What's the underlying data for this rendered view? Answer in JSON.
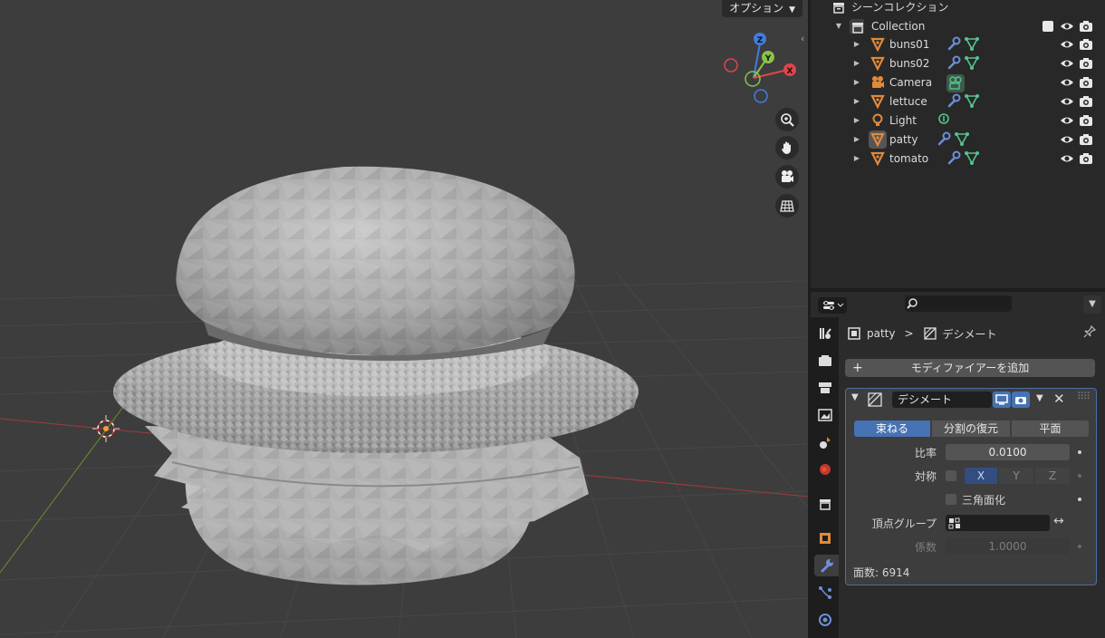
{
  "viewport": {
    "options_label": "オプション",
    "gizmo": {
      "x": "X",
      "y": "Y",
      "z": "Z"
    },
    "nav_icons": [
      "zoom-icon",
      "hand-pan-icon",
      "camera-view-icon",
      "grid-perspective-icon"
    ]
  },
  "outliner": {
    "scene_collection_label": "シーンコレクション",
    "collection_label": "Collection",
    "objects": [
      {
        "name": "buns01",
        "type": "mesh"
      },
      {
        "name": "buns02",
        "type": "mesh"
      },
      {
        "name": "Camera",
        "type": "camera"
      },
      {
        "name": "lettuce",
        "type": "mesh"
      },
      {
        "name": "Light",
        "type": "light"
      },
      {
        "name": "patty",
        "type": "mesh",
        "active": true
      },
      {
        "name": "tomato",
        "type": "mesh"
      }
    ]
  },
  "properties": {
    "breadcrumb_object": "patty",
    "breadcrumb_separator": ">",
    "breadcrumb_modifier": "デシメート",
    "add_modifier_label": "モディファイアーを追加",
    "modifier": {
      "name": "デシメート",
      "modes": [
        "束ねる",
        "分割の復元",
        "平面"
      ],
      "active_mode": "束ねる",
      "ratio_label": "比率",
      "ratio_value": "0.0100",
      "symmetry_label": "対称",
      "axes": [
        "X",
        "Y",
        "Z"
      ],
      "triangulate_label": "三角面化",
      "vertex_group_label": "頂点グループ",
      "factor_label": "係数",
      "factor_value": "1.0000",
      "face_count": "面数: 6914"
    }
  },
  "colors": {
    "accent": "#4772b3",
    "mesh_orange": "#e08a3c",
    "modifier_blue": "#6d8fd6",
    "data_green": "#56c38e",
    "axis_x": "#e0444e",
    "axis_y": "#8bc34a",
    "axis_z": "#3f7de0"
  }
}
